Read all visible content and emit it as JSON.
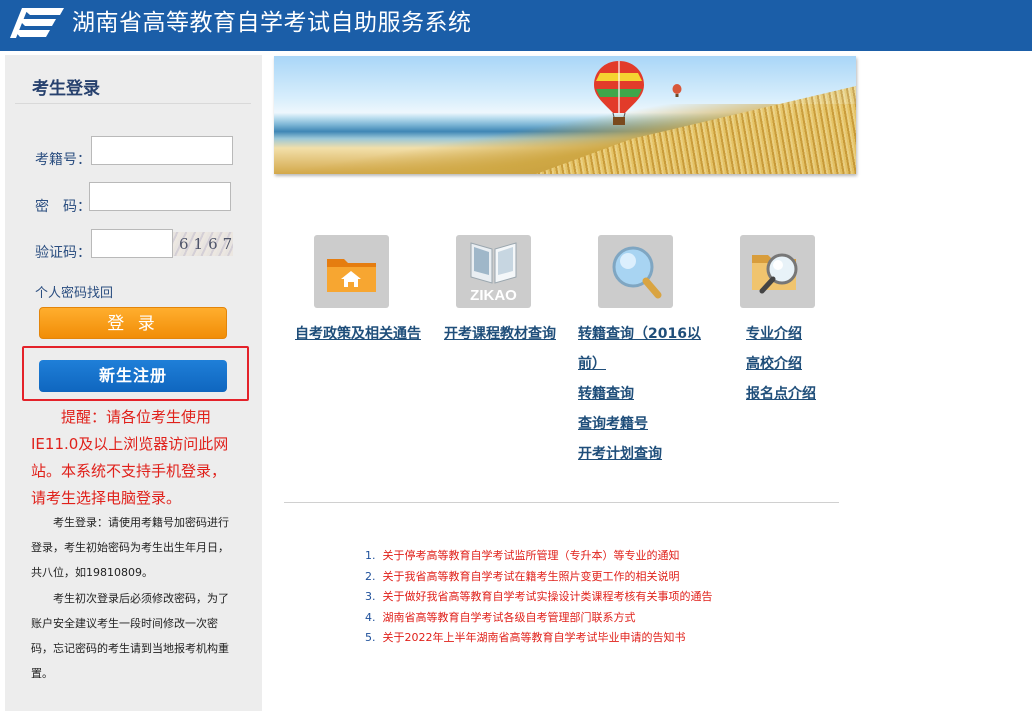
{
  "header": {
    "title": "湖南省高等教育自学考试自助服务系统",
    "background": "#1b5ea8"
  },
  "login": {
    "title": "考生登录",
    "exam_no_label": "考籍号：",
    "password_label": "密　码：",
    "captcha_label": "验证码：",
    "captcha_code": "6167",
    "forgot_link": "个人密码找回",
    "login_button": "登 录",
    "register_button": "新生注册",
    "notice": "提醒：请各位考生使用IE11.0及以上浏览器访问此网站。本系统不支持手机登录，请考生选择电脑登录。",
    "help_1": "考生登录：请使用考籍号加密码进行登录，考生初始密码为考生出生年月日，共八位，如19810809。",
    "help_2": "考生初次登录后必须修改密码，为了账户安全建议考生一段时间修改一次密码，忘记密码的考生请到当地报考机构重置。"
  },
  "tiles": [
    {
      "icon": "folder-home-icon"
    },
    {
      "icon": "zikao-book-icon",
      "text": "ZIKAO"
    },
    {
      "icon": "magnifier-icon"
    },
    {
      "icon": "folder-search-icon"
    }
  ],
  "links": {
    "col1": [
      "自考政策及相关通告"
    ],
    "col2": [
      "开考课程教材查询"
    ],
    "col3": [
      "转籍查询（2016以",
      "前）",
      "转籍查询",
      "查询考籍号",
      "开考计划查询"
    ],
    "col4": [
      "专业介绍",
      "高校介绍",
      "报名点介绍"
    ]
  },
  "news": [
    {
      "num": "1.",
      "text": "关于停考高等教育自学考试监所管理（专升本）等专业的通知"
    },
    {
      "num": "2.",
      "text": "关于我省高等教育自学考试在籍考生照片变更工作的相关说明"
    },
    {
      "num": "3.",
      "text": "关于做好我省高等教育自学考试实操设计类课程考核有关事项的通告"
    },
    {
      "num": "4.",
      "text": "湖南省高等教育自学考试各级自考管理部门联系方式"
    },
    {
      "num": "5.",
      "text": "关于2022年上半年湖南省高等教育自学考试毕业申请的告知书"
    }
  ],
  "colors": {
    "link": "#1f4e7a",
    "notice_red": "#e0211b",
    "login_orange": "#f18d07",
    "register_blue": "#1271cc"
  }
}
